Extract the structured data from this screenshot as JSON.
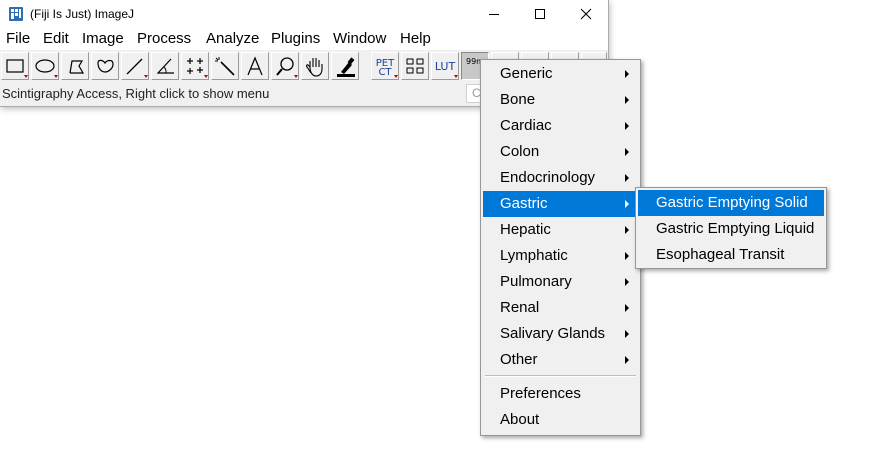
{
  "window": {
    "title": "(Fiji Is Just) ImageJ",
    "controls": [
      "minimize",
      "maximize",
      "close"
    ]
  },
  "menubar": {
    "items": [
      {
        "label": "File"
      },
      {
        "label": "Edit"
      },
      {
        "label": "Image"
      },
      {
        "label": "Process"
      },
      {
        "label": "Analyze"
      },
      {
        "label": "Plugins"
      },
      {
        "label": "Window"
      },
      {
        "label": "Help"
      }
    ]
  },
  "toolbar": {
    "tools": [
      {
        "name": "rectangle-selection",
        "icon": "rectangle-icon"
      },
      {
        "name": "oval-selection",
        "icon": "oval-icon"
      },
      {
        "name": "polygon-selection",
        "icon": "polygon-icon"
      },
      {
        "name": "freehand-selection",
        "icon": "freehand-icon"
      },
      {
        "name": "line-selection",
        "icon": "line-icon"
      },
      {
        "name": "angle-tool",
        "icon": "angle-icon"
      },
      {
        "name": "point-tool",
        "icon": "multipoint-icon"
      },
      {
        "name": "wand-tool",
        "icon": "wand-icon"
      },
      {
        "name": "text-tool",
        "icon": "text-icon"
      },
      {
        "name": "zoom-tool",
        "icon": "magnifier-icon"
      },
      {
        "name": "scroll-tool",
        "icon": "hand-icon"
      },
      {
        "name": "color-picker",
        "icon": "dropper-icon"
      },
      {
        "name": "petct-tool",
        "label_line1": "PET",
        "label_line2": "CT"
      },
      {
        "name": "stack-tool",
        "icon": "grid-icon"
      },
      {
        "name": "lut-tool",
        "label": "LUT"
      },
      {
        "name": "scintigraphy-tool",
        "label": "99m"
      }
    ]
  },
  "status": {
    "text": "Scintigraphy Access, Right click to show menu",
    "search_partial": "C"
  },
  "popup_menu": {
    "items": [
      {
        "label": "Generic",
        "submenu": true
      },
      {
        "label": "Bone",
        "submenu": true
      },
      {
        "label": "Cardiac",
        "submenu": true
      },
      {
        "label": "Colon",
        "submenu": true
      },
      {
        "label": "Endocrinology",
        "submenu": true
      },
      {
        "label": "Gastric",
        "submenu": true,
        "selected": true
      },
      {
        "label": "Hepatic",
        "submenu": true
      },
      {
        "label": "Lymphatic",
        "submenu": true
      },
      {
        "label": "Pulmonary",
        "submenu": true
      },
      {
        "label": "Renal",
        "submenu": true
      },
      {
        "label": "Salivary Glands",
        "submenu": true
      },
      {
        "label": "Other",
        "submenu": true
      }
    ],
    "footer_items": [
      {
        "label": "Preferences"
      },
      {
        "label": "About"
      }
    ]
  },
  "submenu": {
    "items": [
      {
        "label": "Gastric Emptying Solid",
        "selected": true
      },
      {
        "label": "Gastric Emptying Liquid"
      },
      {
        "label": "Esophageal Transit"
      }
    ]
  },
  "colors": {
    "selection": "#0078d7",
    "window_bg": "#f0f0f0",
    "menubar_bg": "#ffffff"
  }
}
